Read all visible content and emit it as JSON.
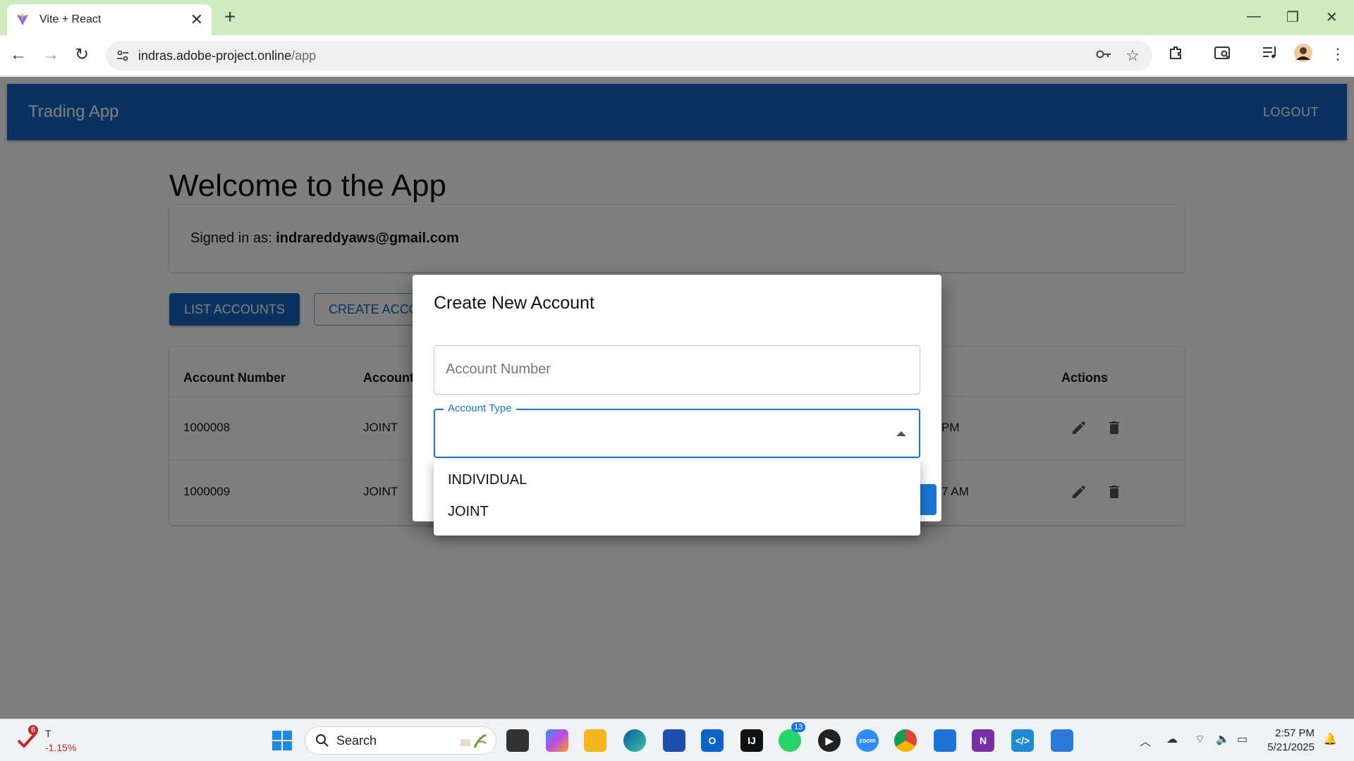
{
  "browser": {
    "tab_title": "Vite + React",
    "url_host": "indras.adobe-project.online",
    "url_path": "/app"
  },
  "app": {
    "title": "Trading App",
    "logout_label": "LOGOUT",
    "welcome": "Welcome to the App",
    "signed_in_prefix": "Signed in as: ",
    "signed_in_email": "indrareddyaws@gmail.com",
    "list_accounts_label": "LIST ACCOUNTS",
    "create_account_label": "CREATE ACCOUNT"
  },
  "table": {
    "headers": [
      "Account Number",
      "Account",
      "Actions"
    ],
    "rows": [
      {
        "number": "1000008",
        "type": "JOINT",
        "time_fragment": "PM"
      },
      {
        "number": "1000009",
        "type": "JOINT",
        "time_fragment": "7 AM"
      }
    ]
  },
  "dialog": {
    "title": "Create New Account",
    "account_number_placeholder": "Account Number",
    "account_type_label": "Account Type",
    "options": [
      "INDIVIDUAL",
      "JOINT"
    ]
  },
  "taskbar": {
    "stock_badge": "6",
    "stock_symbol": "T",
    "stock_change": "-1.15%",
    "search_label": "Search",
    "whatsapp_badge": "13",
    "time": "2:57 PM",
    "date": "5/21/2025"
  },
  "colors": {
    "appbar": "#1565c0",
    "accent": "#1976d2",
    "tabstrip": "#cfeac0"
  }
}
